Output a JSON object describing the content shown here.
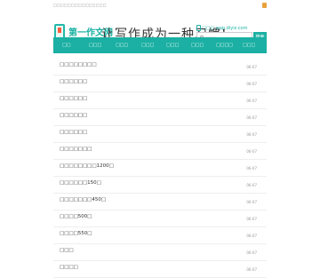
{
  "topbar": {
    "left_text": "□□□□□□□□□□□□□□□",
    "right_icon": "bookmark-icon"
  },
  "header": {
    "logo_title": "第一作文网",
    "logo_sub": "□□□□□□□□□",
    "slogan": "让写作成为一种习惯!",
    "wap_url": "□□□ wap.diyiz.com",
    "search_placeholder": "□□□",
    "search_button": "搜索"
  },
  "nav": {
    "items": [
      "□□",
      "□□□",
      "□□□",
      "□□□",
      "□□□",
      "□□□",
      "□□□□",
      "□□□"
    ]
  },
  "list": [
    {
      "title": "□□□□□□□□",
      "date": "06-07"
    },
    {
      "title": "□□□□□□",
      "date": "06-07"
    },
    {
      "title": "□□□□□□",
      "date": "06-07"
    },
    {
      "title": "□□□□□□",
      "date": "06-07"
    },
    {
      "title": "□□□□□□",
      "date": "06-07"
    },
    {
      "title": "□□□□□□□",
      "date": "06-07"
    },
    {
      "title": "□□□□□□□□1200□",
      "date": "06-07"
    },
    {
      "title": "□□□□□□150□",
      "date": "06-07"
    },
    {
      "title": "□□□□□□□450□",
      "date": "06-07"
    },
    {
      "title": "□□□□500□",
      "date": "06-07"
    },
    {
      "title": "□□□□550□",
      "date": "06-07"
    },
    {
      "title": "□□□",
      "date": "06-07"
    },
    {
      "title": "□□□□",
      "date": "06-07"
    }
  ]
}
